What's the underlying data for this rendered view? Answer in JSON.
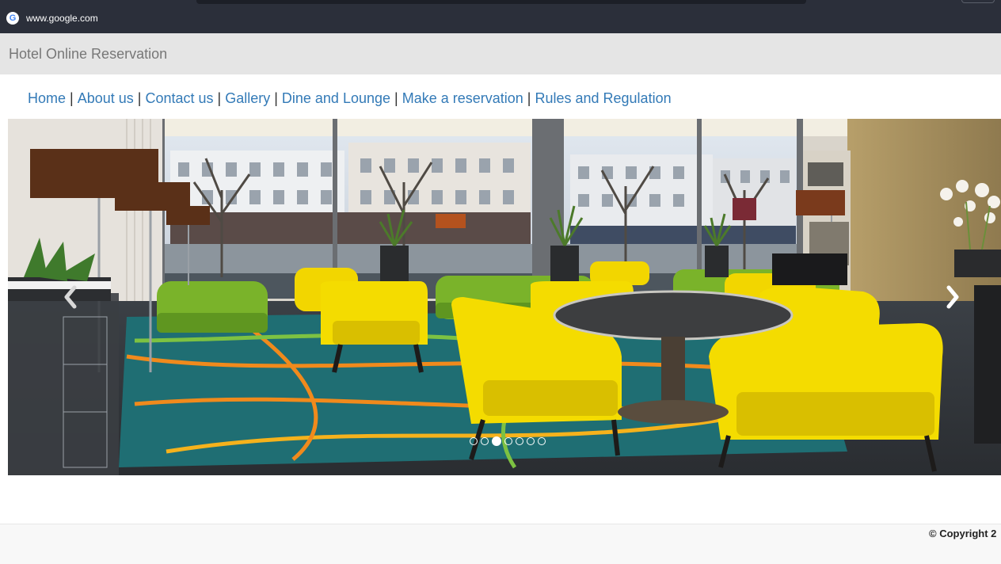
{
  "browser": {
    "url": "www.google.com",
    "favicon_letter": "G"
  },
  "header": {
    "brand": "Hotel Online Reservation"
  },
  "nav": {
    "items": [
      {
        "label": "Home"
      },
      {
        "label": "About us"
      },
      {
        "label": "Contact us"
      },
      {
        "label": "Gallery"
      },
      {
        "label": "Dine and Lounge"
      },
      {
        "label": "Make a reservation"
      },
      {
        "label": "Rules and Regulation"
      }
    ],
    "separator": "|"
  },
  "carousel": {
    "prev_icon": "chevron-left-icon",
    "next_icon": "chevron-right-icon",
    "prev_glyph": "‹",
    "next_glyph": "›",
    "slide_count": 7,
    "active_index": 2
  },
  "footer": {
    "copyright": "© Copyright 2"
  },
  "colors": {
    "link": "#337ab7",
    "header_bg": "#e5e5e5",
    "browser_bar": "#2b2f3a"
  }
}
